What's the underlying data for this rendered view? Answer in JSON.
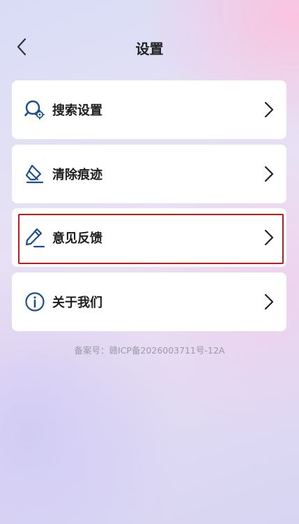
{
  "header": {
    "title": "设置"
  },
  "menu": [
    {
      "label": "搜索设置",
      "icon": "search-settings-icon"
    },
    {
      "label": "清除痕迹",
      "icon": "eraser-icon"
    },
    {
      "label": "意见反馈",
      "icon": "pencil-icon"
    },
    {
      "label": "关于我们",
      "icon": "info-icon"
    }
  ],
  "footer": {
    "icp": "备案号：赣ICP备2026003711号-12A"
  },
  "colors": {
    "icon": "#1a4f8c",
    "highlight": "#c0181e"
  }
}
